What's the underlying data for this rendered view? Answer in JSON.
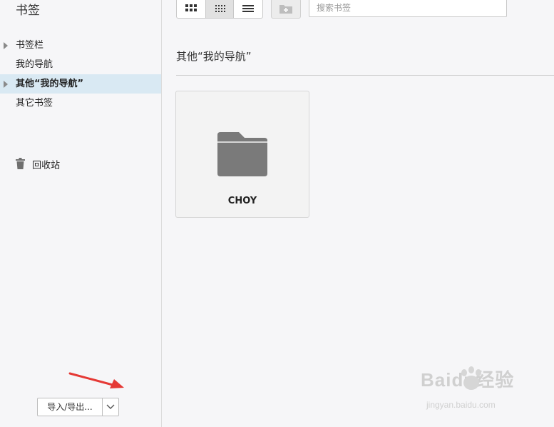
{
  "sidebar": {
    "title": "书签",
    "items": [
      {
        "label": "书签栏",
        "has_arrow": true,
        "active": false
      },
      {
        "label": "我的导航",
        "has_arrow": false,
        "active": false
      },
      {
        "label": "其他“我的导航”",
        "has_arrow": true,
        "active": true
      },
      {
        "label": "其它书签",
        "has_arrow": false,
        "active": false
      }
    ],
    "trash": {
      "label": "回收站",
      "icon": "trash-icon"
    },
    "import_export": {
      "label": "导入/导出...",
      "dropdown_icon": "chevron-down-icon"
    }
  },
  "toolbar": {
    "view_modes": [
      {
        "name": "large-grid-icon",
        "selected": false
      },
      {
        "name": "small-grid-icon",
        "selected": true
      },
      {
        "name": "list-icon",
        "selected": false
      }
    ],
    "new_folder_icon": "new-folder-icon",
    "search": {
      "placeholder": "搜索书签",
      "value": ""
    }
  },
  "main": {
    "folder_title": "其他“我的导航”",
    "tiles": [
      {
        "label": "CHOY",
        "icon": "folder-icon"
      }
    ]
  },
  "watermark": {
    "text": "Baidu经验",
    "url": "jingyan.baidu.com"
  },
  "colors": {
    "active_row": "#d9e9f3",
    "annotation_arrow": "#e53935",
    "folder_icon": "#7a7a7a"
  }
}
